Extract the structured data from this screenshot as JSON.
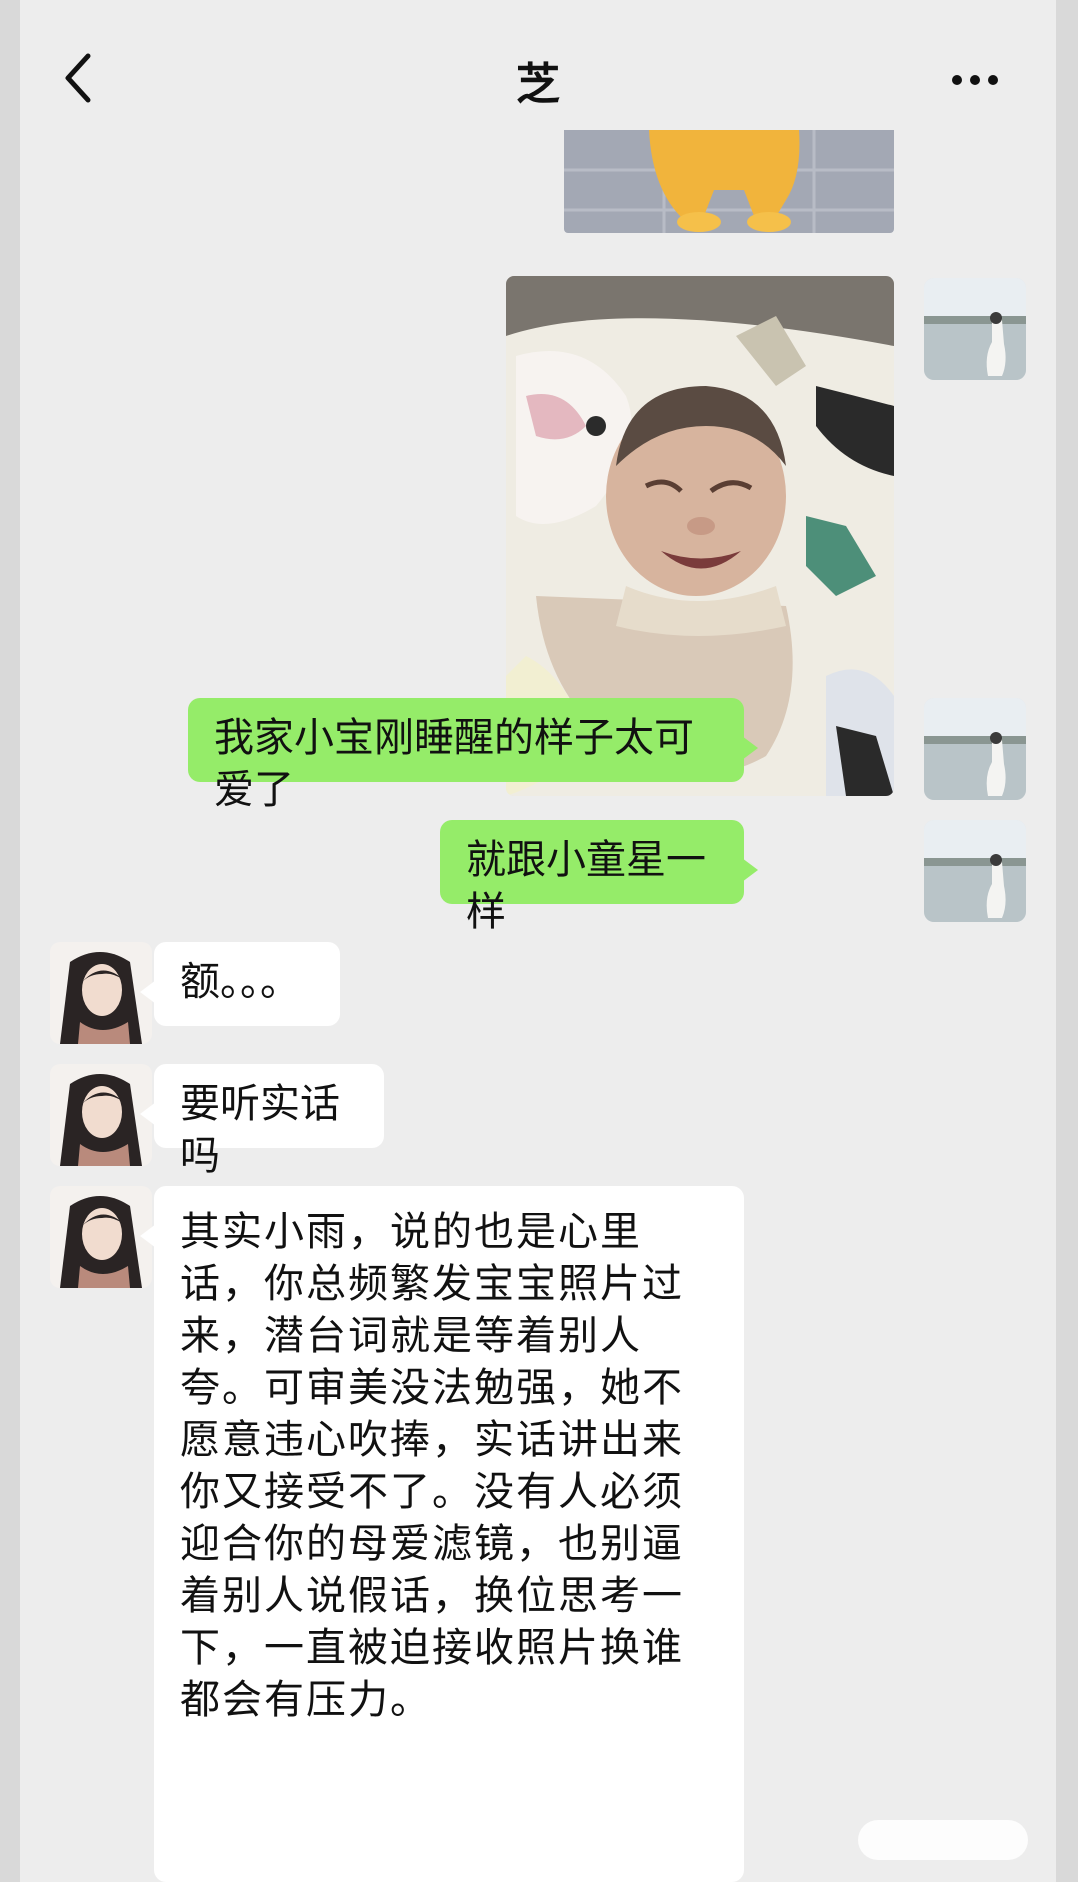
{
  "header": {
    "title": "芝",
    "back_icon": "chevron-left-icon",
    "more_icon": "more-dots-icon"
  },
  "messages": [
    {
      "side": "me",
      "type": "image",
      "label": "partial-photo"
    },
    {
      "side": "me",
      "type": "image",
      "label": "baby-photo"
    },
    {
      "side": "me",
      "type": "text",
      "text": "我家小宝刚睡醒的样子太可爱了"
    },
    {
      "side": "me",
      "type": "text",
      "text": "就跟小童星一样"
    },
    {
      "side": "her",
      "type": "text",
      "text": "额。。。"
    },
    {
      "side": "her",
      "type": "text",
      "text": "要听实话吗"
    },
    {
      "side": "her",
      "type": "text",
      "text": "其实小雨，说的也是心里话，你总频繁发宝宝照片过来，潜台词就是等着别人夸。可审美没法勉强，她不愿意违心吹捧，实话讲出来你又接受不了。没有人必须迎合你的母爱滤镜，也别逼着别人说假话，换位思考一下，一直被迫接收照片换谁都会有压力。"
    }
  ],
  "colors": {
    "background": "#ededed",
    "my_bubble": "#95ec69",
    "her_bubble": "#ffffff"
  }
}
